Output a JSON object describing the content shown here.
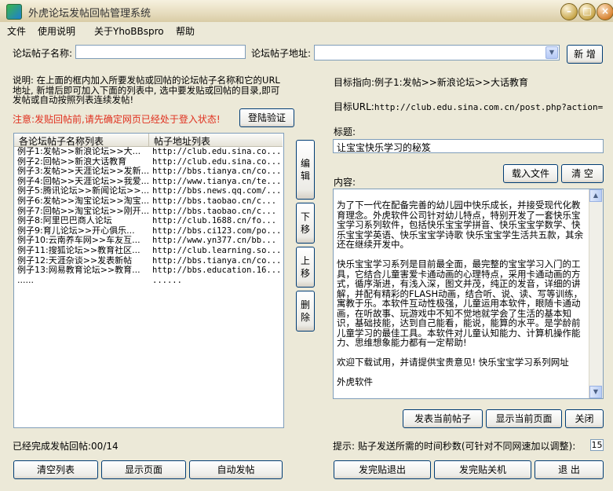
{
  "window": {
    "title": "外虎论坛发帖回帖管理系统"
  },
  "menu": {
    "items": [
      "文件",
      "使用说明",
      "关于YhoBBspro",
      "帮助"
    ]
  },
  "top_form": {
    "post_name_label": "论坛帖子名称:",
    "post_name_value": "",
    "post_url_label": "论坛帖子地址:",
    "post_url_value": "",
    "add_button": "新 增"
  },
  "instructions": {
    "text": "说明: 在上面的框内加入所要发帖或回帖的论坛帖子名称和它的URL地址, 新增后即可加入下面的列表中, 选中要发贴或回帖的目录,即可发帖或自动按照列表连续发帖!",
    "warning": "注意:发贴回帖前,请先确定网页已经处于登入状态!",
    "login_button": "登陆验证"
  },
  "post_list": {
    "headers": [
      "各论坛帖子名称列表",
      "帖子地址列表"
    ],
    "rows": [
      [
        "例子1:发帖>>新浪论坛>>大...",
        "http://club.edu.sina.co..."
      ],
      [
        "例子2:回帖>>新浪大话教育",
        "http://club.edu.sina.co..."
      ],
      [
        "例子3:发帖>>天涯论坛>>发新...",
        "http://bbs.tianya.cn/co..."
      ],
      [
        "例子4:回帖>>天涯论坛>>我爱...",
        "http://www.tianya.cn/te..."
      ],
      [
        "例子5:腾讯论坛>>新闻论坛>>...",
        "http://bbs.news.qq.com/..."
      ],
      [
        "例子6:发帖>>淘宝论坛>>淘宝...",
        "http://bbs.taobao.cn/c..."
      ],
      [
        "例子7:回帖>>淘宝论坛>>刚开...",
        "http://bbs.taobao.cn/c..."
      ],
      [
        "例子8:阿里巴巴商人论坛",
        "http://club.1688.cn/fo..."
      ],
      [
        "例子9:育儿论坛>>开心俱乐...",
        "http://bbs.ci123.com/po..."
      ],
      [
        "例子10:云南养车网>>车友互...",
        "http://www.yn377.cn/bb..."
      ],
      [
        "例子11:搜狐论坛>>教育社区...",
        "http://club.learning.so..."
      ],
      [
        "例子12:天涯杂谈>>发表新帖",
        "http://bbs.tianya.cn/co..."
      ],
      [
        "例子13:网易教育论坛>>教育...",
        "http://bbs.education.16..."
      ],
      [
        "......",
        "......"
      ]
    ]
  },
  "side_buttons": {
    "edit": "编辑",
    "down": "下移",
    "up": "上移",
    "delete": "删除"
  },
  "status": {
    "completed": "已经完成发帖回帖:00/14"
  },
  "bottom_left_buttons": {
    "clear": "清空列表",
    "show_page": "显示页面",
    "auto_post": "自动发帖"
  },
  "target": {
    "direction_label": "目标指向:",
    "direction_value": "例子1:发帖>>新浪论坛>>大话教育",
    "url_label": "目标URL:",
    "url_value": "http://club.edu.sina.com.cn/post.php?action=newthr"
  },
  "editor": {
    "title_label": "标题:",
    "title_value": "让宝宝快乐学习的秘笈",
    "content_label": "内容:",
    "load_button": "载入文件",
    "clear_button": "清 空",
    "content": "为了下一代在配备完善的幼儿园中快乐成长，并接受现代化教育理念。外虎软件公司针对幼儿特点，特别开发了一套快乐宝宝学习系列软件，包括快乐宝宝学拼音、快乐宝宝学数学、快乐宝宝学英语、快乐宝宝学诗歌 快乐宝宝学生活共五款，其余还在继续开发中。\n\n快乐宝宝学习系列是目前最全面，最完整的宝宝学习入门的工具，它结合儿童害爱卡通动画的心理特点，采用卡通动画的方式，循序渐进，有浅入深，图文并茂，纯正的发音，详细的讲解，并配有精彩的FLASH动画，结合听、说、读、写等训练，寓教于乐。本软件互动性极强，儿童运用本软件，眼随卡通动画，在听故事、玩游戏中不知不觉地就学会了生活的基本知识，基础技能，达到自己能看，能说，能算的水平。是学龄前儿童学习的最佳工具。本软件对儿童认知能力、计算机操作能力、思维想象能力都有一定帮助!\n\n欢迎下载试用，并请提供宝贵意见! 快乐宝宝学习系列网址\n\n外虎软件"
  },
  "action_buttons": {
    "publish": "发表当前帖子",
    "show_current": "显示当前页面",
    "close": "关闭"
  },
  "hint": {
    "label": "提示: 贴子发送所需的时间秒数(可针对不同网速加以调整):",
    "value": "15"
  },
  "bottom_right_buttons": {
    "post_exit": "发完贴退出",
    "post_shutdown": "发完贴关机",
    "exit": "退 出"
  }
}
